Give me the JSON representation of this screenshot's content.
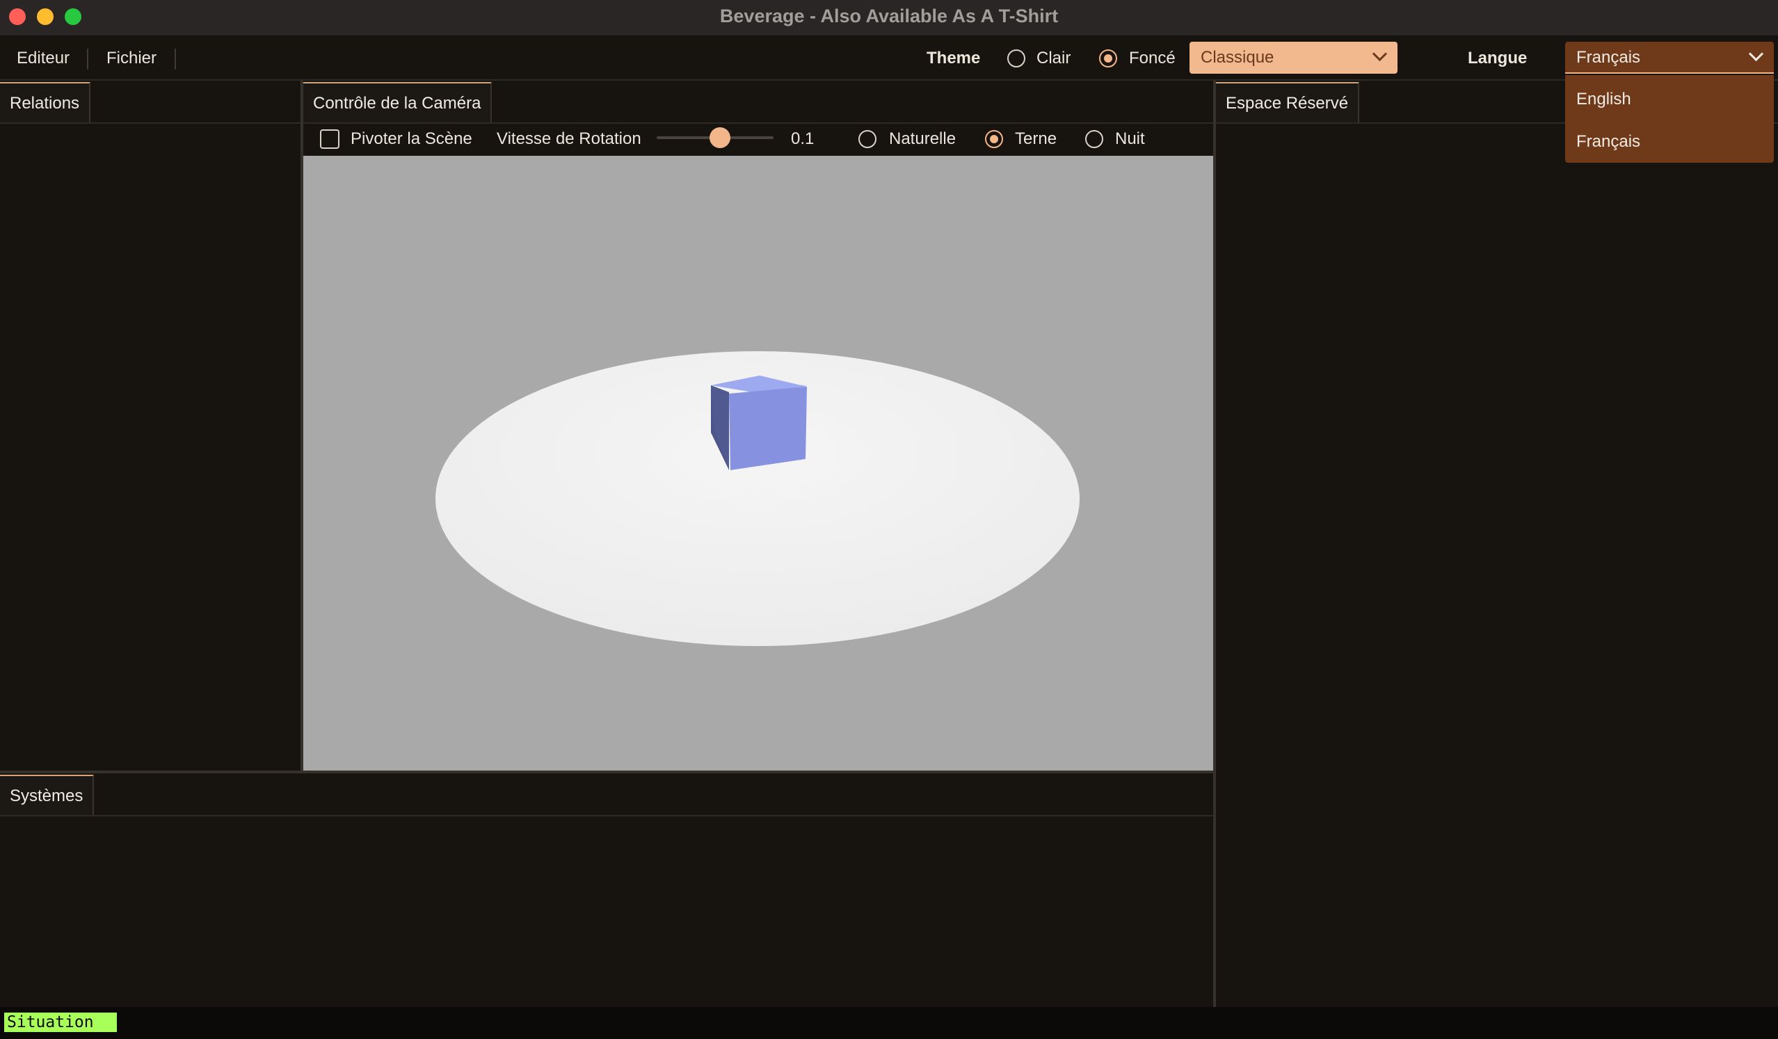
{
  "window": {
    "title": "Beverage - Also Available As A T-Shirt"
  },
  "menubar": {
    "items": [
      "Editeur",
      "Fichier"
    ],
    "theme_label": "Theme",
    "theme_options": [
      {
        "label": "Clair",
        "selected": false
      },
      {
        "label": "Foncé",
        "selected": true
      }
    ],
    "theme_preset": "Classique",
    "language_label": "Langue",
    "language_selected": "Français",
    "language_options": [
      "English",
      "Français"
    ]
  },
  "panels": {
    "left_tab": "Relations",
    "center_tab": "Contrôle de la Caméra",
    "right_tab": "Espace Réservé",
    "bottom_tab": "Systèmes"
  },
  "camera": {
    "rotate_label": "Pivoter la Scène",
    "rotate_checked": false,
    "speed_label": "Vitesse de Rotation",
    "speed_value": "0.1",
    "lighting_options": [
      {
        "label": "Naturelle",
        "selected": false
      },
      {
        "label": "Terne",
        "selected": true
      },
      {
        "label": "Nuit",
        "selected": false
      }
    ]
  },
  "status": {
    "text": "Situation"
  },
  "colors": {
    "accent": "#f3b58a",
    "background": "#17130f",
    "dropdown_popup": "#6e3a1a",
    "status_chip": "#a8ff5a",
    "viewport_bg": "#a9a9a9",
    "cube": "#8795e0"
  }
}
